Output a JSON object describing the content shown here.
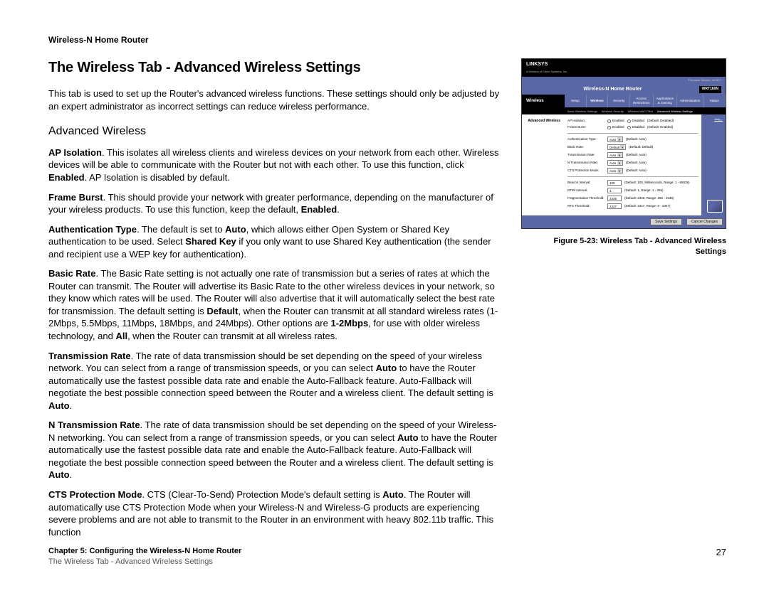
{
  "header": "Wireless-N Home Router",
  "page_title": "The Wireless Tab - Advanced Wireless Settings",
  "intro": "This tab is used to set up the Router's advanced wireless functions. These settings should only be adjusted by an expert administrator as incorrect settings can reduce wireless performance.",
  "section_heading": "Advanced Wireless",
  "paragraphs": {
    "ap_isolation": {
      "label": "AP Isolation",
      "text1": ". This isolates all wireless clients and wireless devices on your network from each other. Wireless devices will be able to communicate with the Router but not with each other. To use this function, click ",
      "enabled": "Enabled",
      "text2": ". AP Isolation is disabled by default."
    },
    "frame_burst": {
      "label": "Frame Burst",
      "text1": ". This should provide your network with greater performance, depending on the manufacturer of your wireless products. To use this function, keep the default, ",
      "enabled": "Enabled",
      "text2": "."
    },
    "auth_type": {
      "label": "Authentication Type",
      "text1": ". The default is set to ",
      "auto": "Auto",
      "text2": ", which allows either Open System or Shared Key authentication to be used. Select ",
      "shared": "Shared Key",
      "text3": " if you only want to use Shared Key authentication (the sender and recipient use a WEP key for authentication)."
    },
    "basic_rate": {
      "label": "Basic Rate",
      "text1": ". The Basic Rate setting is not actually one rate of transmission but a series of rates at which the Router can transmit. The Router will advertise its Basic Rate to the other wireless devices in your network, so they know which rates will be used. The Router will also advertise that it will automatically select the best rate for transmission. The default setting is ",
      "default": "Default",
      "text2": ", when the Router can transmit at all standard wireless rates (1-2Mbps, 5.5Mbps, 11Mbps, 18Mbps, and 24Mbps). Other options are ",
      "one_two": "1-2Mbps",
      "text3": ", for use with older wireless technology, and ",
      "all": "All",
      "text4": ", when the Router can transmit at all wireless rates."
    },
    "trans_rate": {
      "label": "Transmission Rate",
      "text1": ". The rate of data transmission should be set depending on the speed of your wireless network. You can select from a range of transmission speeds, or you can select ",
      "auto": "Auto",
      "text2": " to have the Router automatically use the fastest possible data rate and enable the Auto-Fallback feature. Auto-Fallback will negotiate the best possible connection speed between the Router and a wireless client. The default setting is ",
      "auto2": "Auto",
      "text3": "."
    },
    "n_trans_rate": {
      "label": "N Transmission Rate",
      "text1": ". The rate of data transmission should be set depending on the speed of your Wireless-N networking. You can select from a range of transmission speeds, or you can select ",
      "auto": "Auto",
      "text2": " to have the Router automatically use the fastest possible data rate and enable the Auto-Fallback feature. Auto-Fallback will negotiate the best possible connection speed between the Router and a wireless client. The default setting is ",
      "auto2": "Auto",
      "text3": "."
    },
    "cts": {
      "label": "CTS Protection Mode",
      "text1": ". CTS (Clear-To-Send) Protection Mode's default setting is ",
      "auto": "Auto",
      "text2": ". The Router will automatically use CTS Protection Mode when your Wireless-N and Wireless-G products are experiencing severe problems and are not able to transmit to the Router in an environment with heavy 802.11b traffic. This function"
    }
  },
  "figure": {
    "caption": "Figure 5-23: Wireless Tab - Advanced Wireless Settings",
    "brand": "LINKSYS",
    "brand_sub": "A Division of Cisco Systems, Inc.",
    "firmware": "Firmware Version: v0.00.7",
    "product": "Wireless-N Home Router",
    "model": "WRT160N",
    "side_label": "Wireless",
    "tabs": [
      "Setup",
      "Wireless",
      "Security",
      "Access Restrictions",
      "Applications & Gaming",
      "Administration",
      "Status"
    ],
    "subtabs": [
      "Basic Wireless Settings",
      "Wireless Security",
      "Wireless MAC Filter",
      "Advanced Wireless Settings"
    ],
    "section": "Advanced Wireless",
    "rows": {
      "ap": {
        "label": "AP Isolation:",
        "opt1": "Enabled",
        "opt2": "Disabled",
        "hint": "(Default: Disabled)"
      },
      "fb": {
        "label": "Frame Burst:",
        "opt1": "Enabled",
        "opt2": "Disabled",
        "hint": "(Default: Enabled)"
      },
      "auth": {
        "label": "Authentication Type:",
        "val": "Auto",
        "hint": "(Default: Auto)"
      },
      "basic": {
        "label": "Basic Rate:",
        "val": "Default",
        "hint": "(Default: Default)"
      },
      "tr": {
        "label": "Transmission Rate:",
        "val": "Auto",
        "hint": "(Default: Auto)"
      },
      "ntr": {
        "label": "N Transmission Rate:",
        "val": "Auto",
        "hint": "(Default: Auto)"
      },
      "cts": {
        "label": "CTS Protection Mode:",
        "val": "Auto",
        "hint": "(Default: Auto)"
      },
      "beacon": {
        "label": "Beacon Interval:",
        "val": "100",
        "hint": "(Default: 100, Milliseconds, Range: 1 - 65535)"
      },
      "dtim": {
        "label": "DTIM Interval:",
        "val": "1",
        "hint": "(Default: 1, Range: 1 - 255)"
      },
      "frag": {
        "label": "Fragmentation Threshold:",
        "val": "2346",
        "hint": "(Default: 2346, Range: 256 - 2346)"
      },
      "rts": {
        "label": "RTS Threshold:",
        "val": "2347",
        "hint": "(Default: 2347, Range: 0 - 2347)"
      }
    },
    "help": "Help...",
    "btn_save": "Save Settings",
    "btn_cancel": "Cancel Changes"
  },
  "footer": {
    "chapter": "Chapter 5: Configuring the Wireless-N Home Router",
    "section": "The Wireless Tab - Advanced Wireless Settings",
    "page": "27"
  }
}
